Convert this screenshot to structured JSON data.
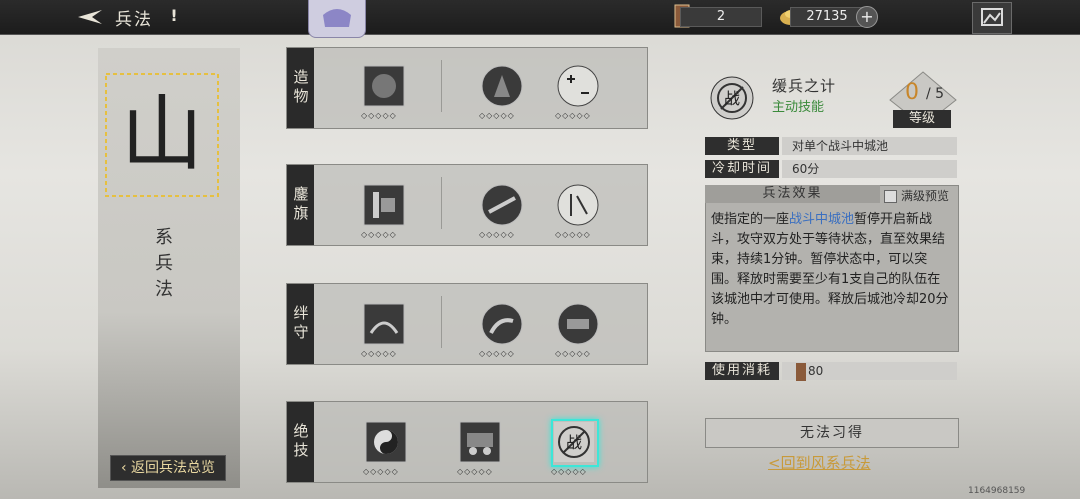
{
  "header": {
    "title": "兵法",
    "info_icon": "!",
    "resources": [
      {
        "icon": "token-card-icon",
        "value": "2"
      },
      {
        "icon": "gold-ingot-icon",
        "value": "27135"
      }
    ],
    "plus_label": "+"
  },
  "school": {
    "glyph": "山",
    "name": "系兵法",
    "back_label": "返回兵法总览"
  },
  "rows": [
    {
      "label": "造物",
      "skills": [
        "skill-icon",
        "warrior-icon",
        "plus-minus-icon"
      ]
    },
    {
      "label": "鏖旗",
      "skills": [
        "banner-icon",
        "charge-icon",
        "scroll-icon"
      ]
    },
    {
      "label": "绊守",
      "skills": [
        "rider-icon",
        "horse-icon",
        "cannon-icon"
      ]
    },
    {
      "label": "绝技",
      "skills": [
        "bagua-icon",
        "chariot-icon",
        "no-battle-icon"
      ]
    }
  ],
  "detail": {
    "name": "缓兵之计",
    "kind": "主动技能",
    "level_current": "0",
    "level_max": "/ 5",
    "level_label": "等级",
    "type_label": "类型",
    "type_value": "对单个战斗中城池",
    "cooldown_label": "冷却时间",
    "cooldown_value": "60分",
    "effect_header": "兵法效果",
    "preview_label": "满级预览",
    "effect_pre": "使指定的一座",
    "effect_highlight": "战斗中城池",
    "effect_post": "暂停开启新战斗，攻守双方处于等待状态，直至效果结束，持续1分钟。暂停状态中，可以突围。释放时需要至少有1支自己的队伍在该城池中才可使用。释放后城池冷却20分钟。",
    "cost_label": "使用消耗",
    "cost_value": "80",
    "learn_label": "无法习得",
    "return_label": "<回到风系兵法"
  },
  "footer": {
    "uid": "1164968159"
  },
  "colors": {
    "accent_gold": "#c89a3a",
    "highlight_blue": "#3a6fc0",
    "select_cyan": "#3de6d8",
    "skill_green": "#3a8a3a"
  }
}
